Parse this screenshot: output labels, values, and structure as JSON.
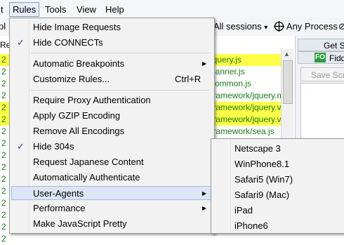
{
  "menubar": {
    "items": [
      {
        "label": "t"
      },
      {
        "label": "Rules"
      },
      {
        "label": "Tools"
      },
      {
        "label": "View"
      },
      {
        "label": "Help"
      }
    ]
  },
  "toolbar": {
    "left_fragment": "pl",
    "sessions_label": "All sessions",
    "sessions_arrow": "▾",
    "process_label": "Any Process",
    "process_icon": "crosshair-icon",
    "right_fragment": "⊘"
  },
  "sessions": {
    "header_fragment": "Re",
    "rows": [
      {
        "num": "2",
        "url": "jquery.js",
        "highlight": true
      },
      {
        "num": "2",
        "url": "banner.js",
        "highlight": false
      },
      {
        "num": "2",
        "url": "common.js",
        "highlight": false
      },
      {
        "num": "2",
        "url": "framework/jquery.m",
        "highlight": false
      },
      {
        "num": "2",
        "url": "framework/jquery.va",
        "highlight": true
      },
      {
        "num": "2",
        "url": "framework/jquery.va",
        "highlight": true
      },
      {
        "num": "2",
        "url": "framework/sea.js",
        "highlight": false
      },
      {
        "num": "2",
        "url": "",
        "highlight": false
      },
      {
        "num": "2",
        "url": "",
        "highlight": false
      },
      {
        "num": "2",
        "url": "",
        "highlight": false
      },
      {
        "num": "2",
        "url": "",
        "highlight": false
      },
      {
        "num": "2",
        "url": "",
        "highlight": false
      },
      {
        "num": "2",
        "url": "",
        "highlight": false
      },
      {
        "num": "2",
        "url": "",
        "highlight": false
      },
      {
        "num": "2",
        "url": "",
        "highlight": false
      },
      {
        "num": "2",
        "url": "",
        "highlight": false
      }
    ]
  },
  "right_panel": {
    "tab1": "Get Sta",
    "tab2": "Fiddl",
    "fo_badge": "FO",
    "save_button": "Save Scrip"
  },
  "rules_menu": {
    "items": [
      {
        "label": "Hide Image Requests",
        "checked": false
      },
      {
        "label": "Hide CONNECTs",
        "checked": true
      },
      {
        "label": "Automatic Breakpoints",
        "submenu": true
      },
      {
        "label": "Customize Rules...",
        "shortcut": "Ctrl+R"
      },
      {
        "label": "Require Proxy Authentication"
      },
      {
        "label": "Apply GZIP Encoding"
      },
      {
        "label": "Remove All Encodings"
      },
      {
        "label": "Hide 304s",
        "checked": true
      },
      {
        "label": "Request Japanese Content"
      },
      {
        "label": "Automatically Authenticate"
      },
      {
        "label": "User-Agents",
        "submenu": true,
        "hover": true
      },
      {
        "label": "Performance",
        "submenu": true
      },
      {
        "label": "Make JavaScript Pretty"
      }
    ],
    "check_glyph": "✓",
    "arrow_glyph": "▶"
  },
  "user_agents_submenu": {
    "items": [
      "Netscape 3",
      "WinPhone8.1",
      "Safari5 (Win7)",
      "Safari9 (Mac)",
      "iPad",
      "iPhone6"
    ]
  }
}
